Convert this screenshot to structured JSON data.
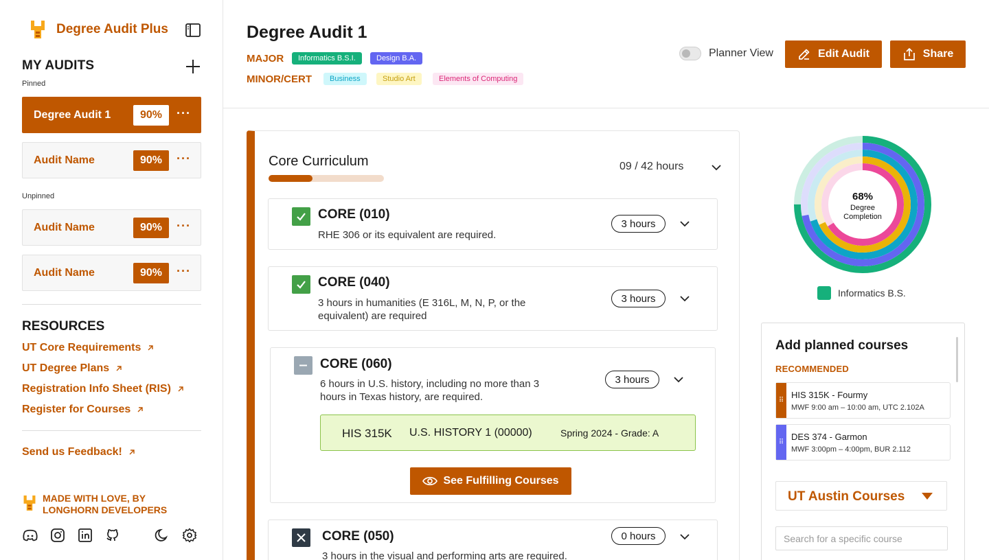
{
  "brand": {
    "name": "Degree Audit Plus"
  },
  "sidebar": {
    "my_audits_title": "MY AUDITS",
    "pinned_label": "Pinned",
    "unpinned_label": "Unpinned",
    "pinned": [
      {
        "name": "Degree Audit 1",
        "percent": "90%",
        "active": true
      },
      {
        "name": "Audit Name",
        "percent": "90%",
        "active": false
      }
    ],
    "unpinned": [
      {
        "name": "Audit Name",
        "percent": "90%"
      },
      {
        "name": "Audit Name",
        "percent": "90%"
      }
    ],
    "resources_title": "RESOURCES",
    "resources": [
      "UT Core Requirements",
      "UT Degree Plans",
      "Registration Info Sheet (RIS)",
      "Register for Courses"
    ],
    "feedback": "Send us Feedback!",
    "made_with": [
      "MADE WITH LOVE, BY",
      "LONGHORN DEVELOPERS"
    ],
    "social_icons": [
      "discord-icon",
      "instagram-icon",
      "linkedin-icon",
      "github-icon",
      "moon-icon",
      "settings-icon"
    ]
  },
  "header": {
    "title": "Degree Audit 1",
    "major_label": "MAJOR",
    "majors": [
      {
        "label": "Informatics B.S.I.",
        "bg": "#16b07b",
        "fg": "#ffffff"
      },
      {
        "label": "Design B.A.",
        "bg": "#6366f1",
        "fg": "#ffffff"
      }
    ],
    "minor_label": "MINOR/CERT",
    "minors": [
      {
        "label": "Business",
        "bg": "#cff7fb",
        "fg": "#0ea5c6"
      },
      {
        "label": "Studio Art",
        "bg": "#fef6c3",
        "fg": "#c5a012"
      },
      {
        "label": "Elements of Computing",
        "bg": "#fce7f3",
        "fg": "#db2777"
      }
    ],
    "planner_view_label": "Planner View",
    "planner_view_on": false,
    "edit_label": "Edit Audit",
    "share_label": "Share"
  },
  "core": {
    "title": "Core Curriculum",
    "hours": "09 / 42 hours",
    "progress": 0.38,
    "requirements": [
      {
        "title": "CORE (010)",
        "desc": [
          "RHE 306 or its equivalent are required."
        ],
        "hours": "3 hours",
        "status": "complete"
      },
      {
        "title": "CORE (040)",
        "desc": [
          "3 hours in humanities (E 316L, M, N, P, or the",
          "equivalent) are required"
        ],
        "hours": "3 hours",
        "status": "complete"
      },
      {
        "title": "CORE (060)",
        "desc": [
          "6 hours in U.S. history, including no more than 3",
          "hours in Texas history, are required."
        ],
        "hours": "3 hours",
        "status": "partial",
        "course": {
          "code": "HIS 315K",
          "name": "U.S. HISTORY 1 (00000)",
          "term": "Spring 2024 - Grade: A"
        },
        "fulfill_label": "See Fulfilling Courses"
      },
      {
        "title": "CORE (050)",
        "desc": [
          "3 hours in the visual and performing arts are required."
        ],
        "hours": "0 hours",
        "status": "incomplete"
      }
    ]
  },
  "completion": {
    "percent_label": "68%",
    "caption": [
      "Degree",
      "Completion"
    ],
    "legend": "Informatics B.S.",
    "rings": [
      {
        "color": "#16b07b",
        "fraction": 0.75
      },
      {
        "color": "#6366f1",
        "fraction": 0.72
      },
      {
        "color": "#0ea5c6",
        "fraction": 0.7
      },
      {
        "color": "#eab308",
        "fraction": 0.68
      },
      {
        "color": "#ec4899",
        "fraction": 0.66
      }
    ]
  },
  "planned": {
    "title": "Add planned courses",
    "recommended_label": "RECOMMENDED",
    "courses": [
      {
        "name": "HIS 315K - Fourmy",
        "meta": "MWF 9:00 am – 10:00 am, UTC 2.102A",
        "color": "#BF5700"
      },
      {
        "name": "DES 374 - Garmon",
        "meta": "MWF 3:00pm – 4:00pm, BUR 2.112",
        "color": "#6366f1"
      }
    ],
    "catalog_label": "UT Austin Courses",
    "search_placeholder": "Search for a specific course"
  }
}
